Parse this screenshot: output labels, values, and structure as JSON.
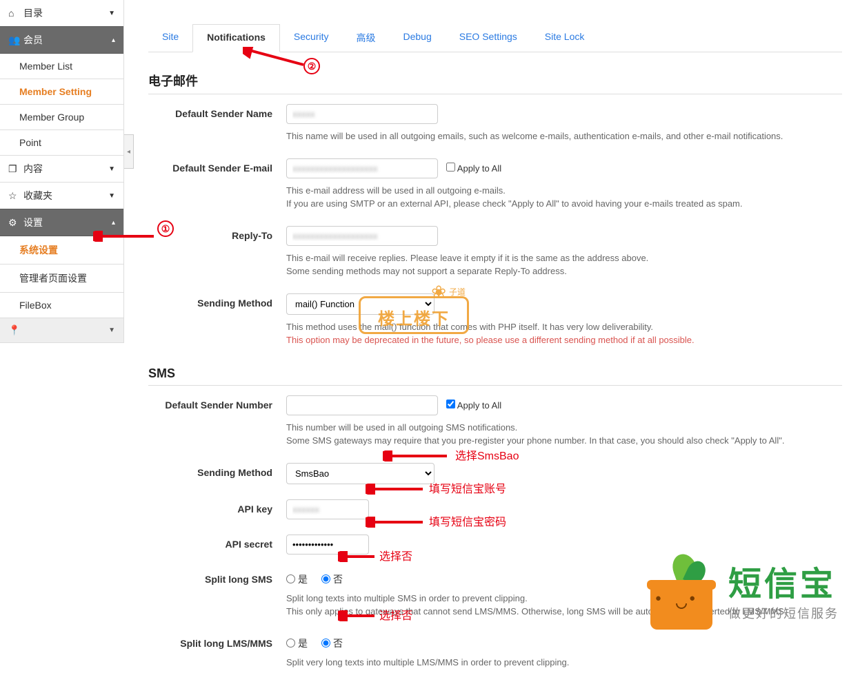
{
  "sidebar": {
    "directory": "目录",
    "member": "会员",
    "memberItems": [
      "Member List",
      "Member Setting",
      "Member Group",
      "Point"
    ],
    "content": "内容",
    "favorite": "收藏夹",
    "settings": "设置",
    "settingsItems": [
      "系统设置",
      "管理者页面设置",
      "FileBox"
    ]
  },
  "tabs": [
    "Site",
    "Notifications",
    "Security",
    "高级",
    "Debug",
    "SEO Settings",
    "Site Lock"
  ],
  "email": {
    "heading": "电子邮件",
    "senderName": {
      "label": "Default Sender Name",
      "value": "xxxxx",
      "help": "This name will be used in all outgoing emails, such as welcome e-mails, authentication e-mails, and other e-mail notifications."
    },
    "senderEmail": {
      "label": "Default Sender E-mail",
      "value": "xxxxxxxxxxxxxxxxxxx",
      "apply": "Apply to All",
      "help1": "This e-mail address will be used in all outgoing e-mails.",
      "help2": "If you are using SMTP or an external API, please check \"Apply to All\" to avoid having your e-mails treated as spam."
    },
    "replyTo": {
      "label": "Reply-To",
      "value": "xxxxxxxxxxxxxxxxxxx",
      "help1": "This e-mail will receive replies. Please leave it empty if it is the same as the address above.",
      "help2": "Some sending methods may not support a separate Reply-To address."
    },
    "method": {
      "label": "Sending Method",
      "value": "mail() Function",
      "help1": "This method uses the mail() function that comes with PHP itself. It has very low deliverability.",
      "help2": "This option may be deprecated in the future, so please use a different sending method if at all possible."
    }
  },
  "sms": {
    "heading": "SMS",
    "senderNum": {
      "label": "Default Sender Number",
      "value": "",
      "apply": "Apply to All",
      "help1": "This number will be used in all outgoing SMS notifications.",
      "help2": "Some SMS gateways may require that you pre-register your phone number. In that case, you should also check \"Apply to All\"."
    },
    "method": {
      "label": "Sending Method",
      "value": "SmsBao"
    },
    "apiKey": {
      "label": "API key",
      "value": "xxxxxx"
    },
    "apiSecret": {
      "label": "API secret",
      "value": "•••••••••••••"
    },
    "splitSms": {
      "label": "Split long SMS",
      "yes": "是",
      "no": "否",
      "help1": "Split long texts into multiple SMS in order to prevent clipping.",
      "help2": "This only applies to gateways that cannot send LMS/MMS. Otherwise, long SMS will be automatically converted to LMS/MMS."
    },
    "splitLms": {
      "label": "Split long LMS/MMS",
      "yes": "是",
      "no": "否",
      "help1": "Split very long texts into multiple LMS/MMS in order to prevent clipping."
    }
  },
  "annotations": {
    "n1": "①",
    "n2": "②",
    "selectSmsBao": "选择SmsBao",
    "fillAccount": "填写短信宝账号",
    "fillPassword": "填写短信宝密码",
    "selectNo1": "选择否",
    "selectNo2": "选择否"
  },
  "watermark": {
    "main": "楼上楼下",
    "sub": "子道"
  },
  "brand": {
    "name": "短信宝",
    "slogan": "做更好的短信服务"
  }
}
